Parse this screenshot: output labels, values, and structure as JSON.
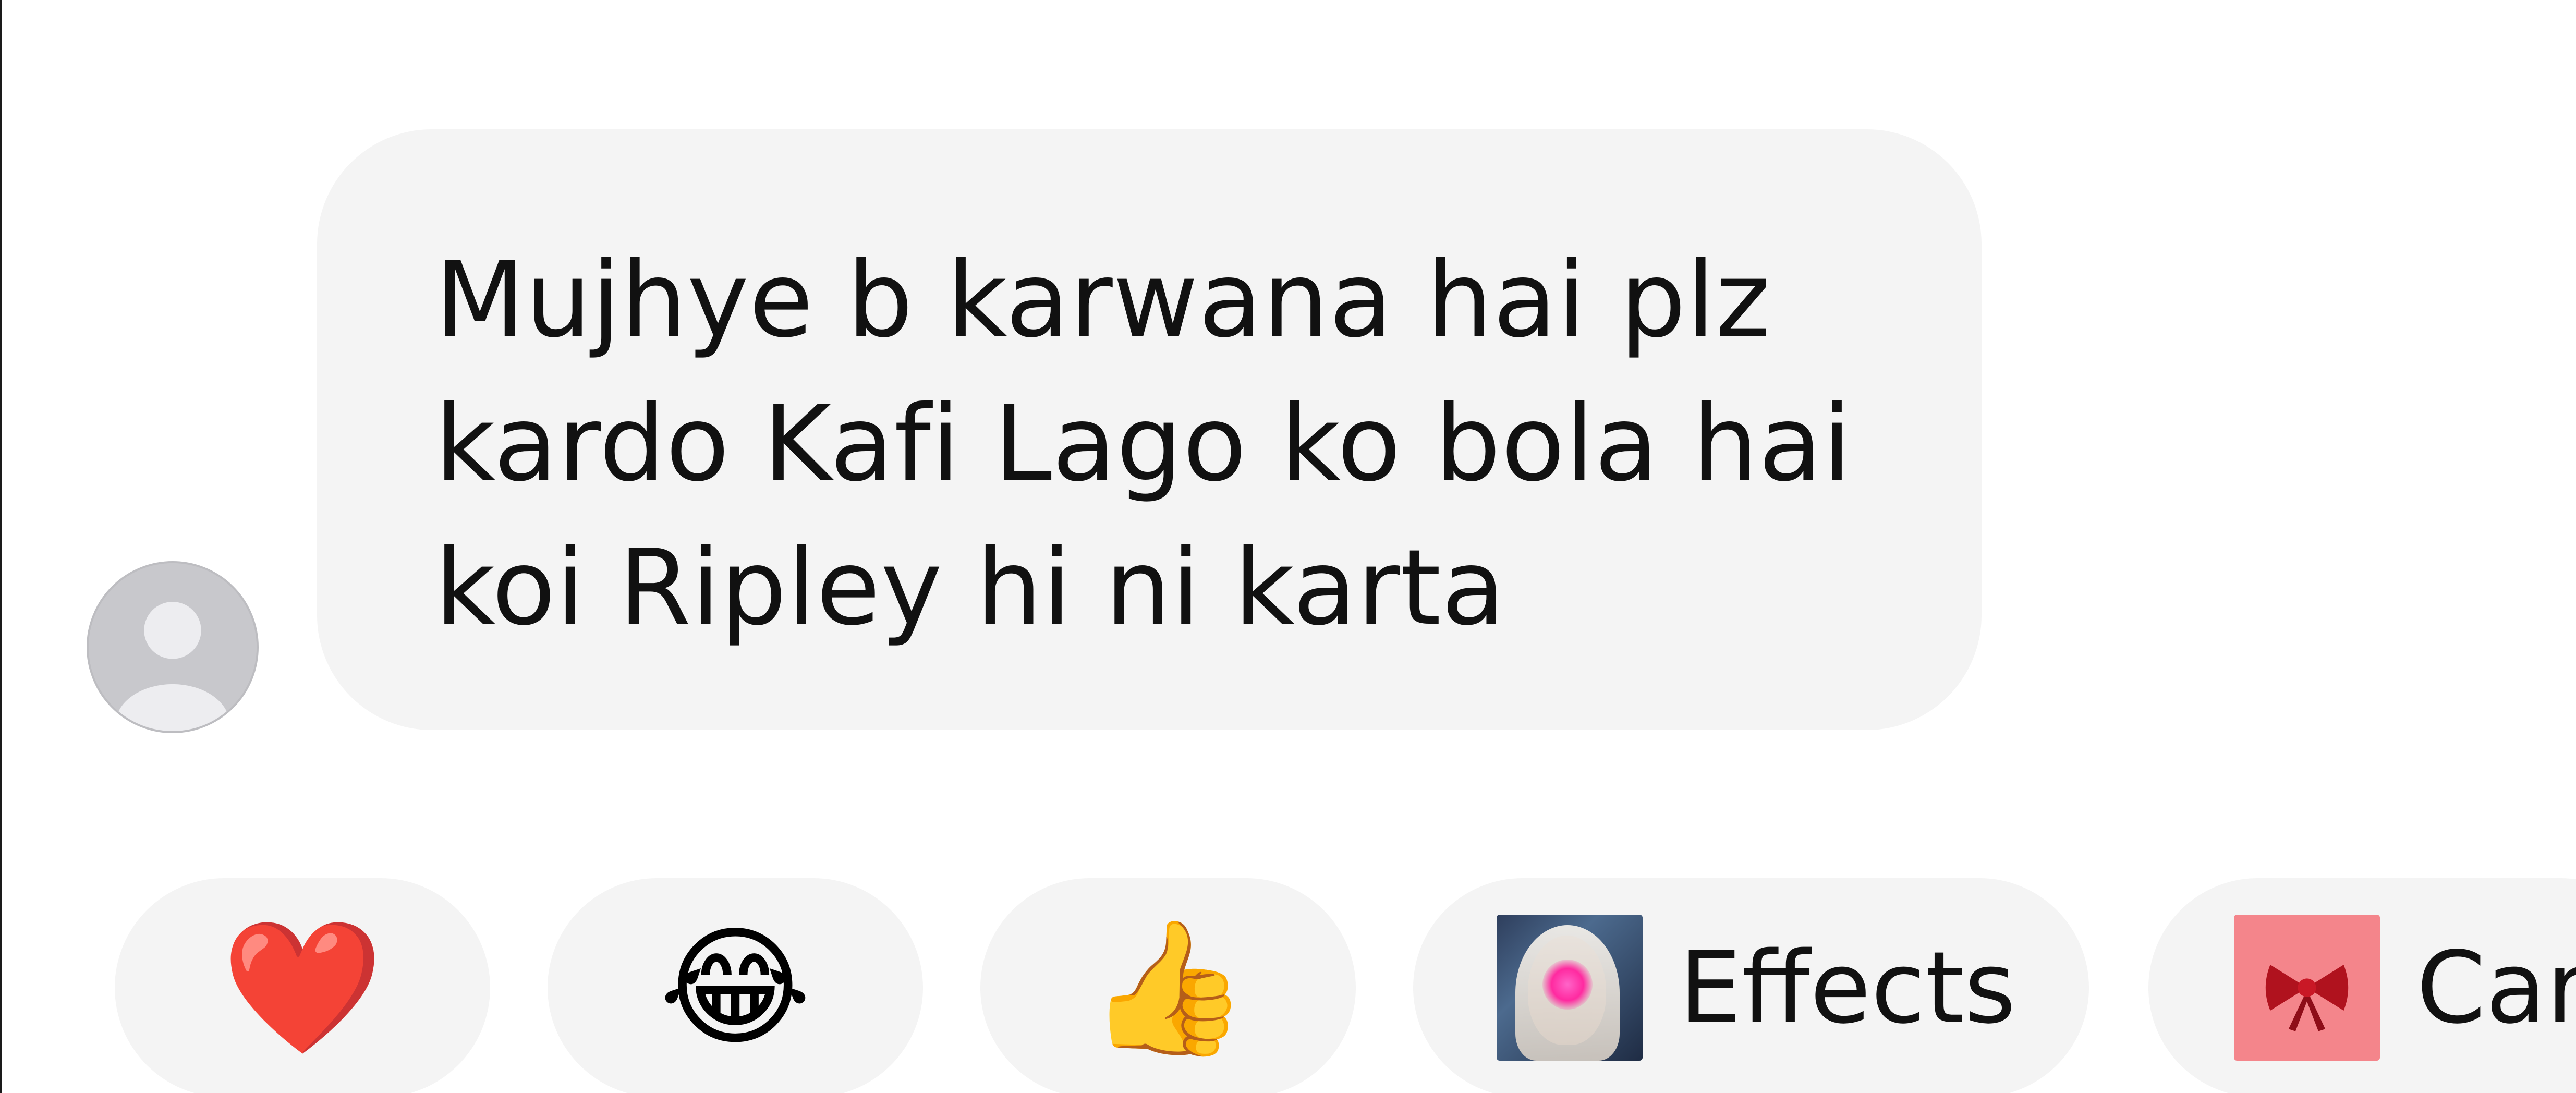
{
  "message": {
    "text": "Mujhye b karwana hai plz\nkardo Kafi Lago ko bola hai\nkoi Ripley hi ni karta"
  },
  "reactions": {
    "heart": "❤️",
    "laugh": "😂",
    "thumbs_up": "👍",
    "effects_label": "Effects",
    "cards_label": "Car"
  },
  "icons": {
    "avatar": "default-profile-icon",
    "effects": "effects-preview-icon",
    "cards": "bow-card-icon"
  },
  "colors": {
    "bubble": "#f4f4f4",
    "pill": "#f4f4f4",
    "avatar": "#c8c8cc",
    "cards_thumb": "#f4858b",
    "text": "#111111"
  }
}
